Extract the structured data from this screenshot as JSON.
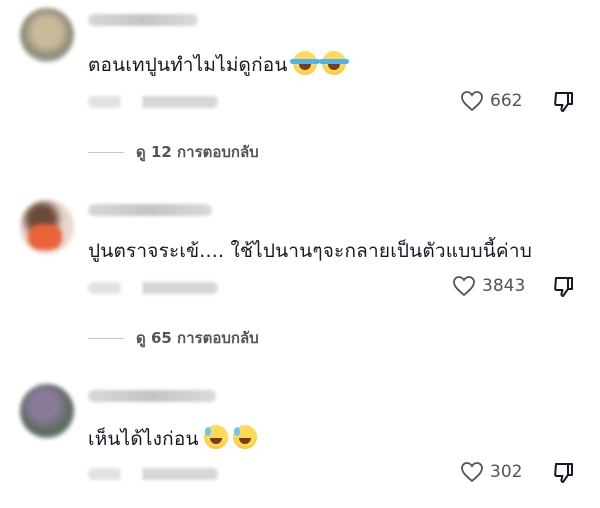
{
  "comments": [
    {
      "text": "ตอนเทปูนทำไมไม่ดูก่อน",
      "emojis": [
        "face-with-tears-of-joy",
        "face-with-tears-of-joy"
      ],
      "likes": "662",
      "replies_label": "ดู 12 การตอบกลับ"
    },
    {
      "text": "ปูนตราจระเข้.... ใช้ไปนานๆจะกลายเป็นตัวแบบนี้ค่าบ",
      "emojis": [],
      "likes": "3843",
      "replies_label": "ดู 65 การตอบกลับ"
    },
    {
      "text": "เห็นได้ไงก่อน",
      "emojis": [
        "grinning-face-with-sweat",
        "grinning-face-with-sweat"
      ],
      "likes": "302",
      "replies_label": ""
    }
  ]
}
